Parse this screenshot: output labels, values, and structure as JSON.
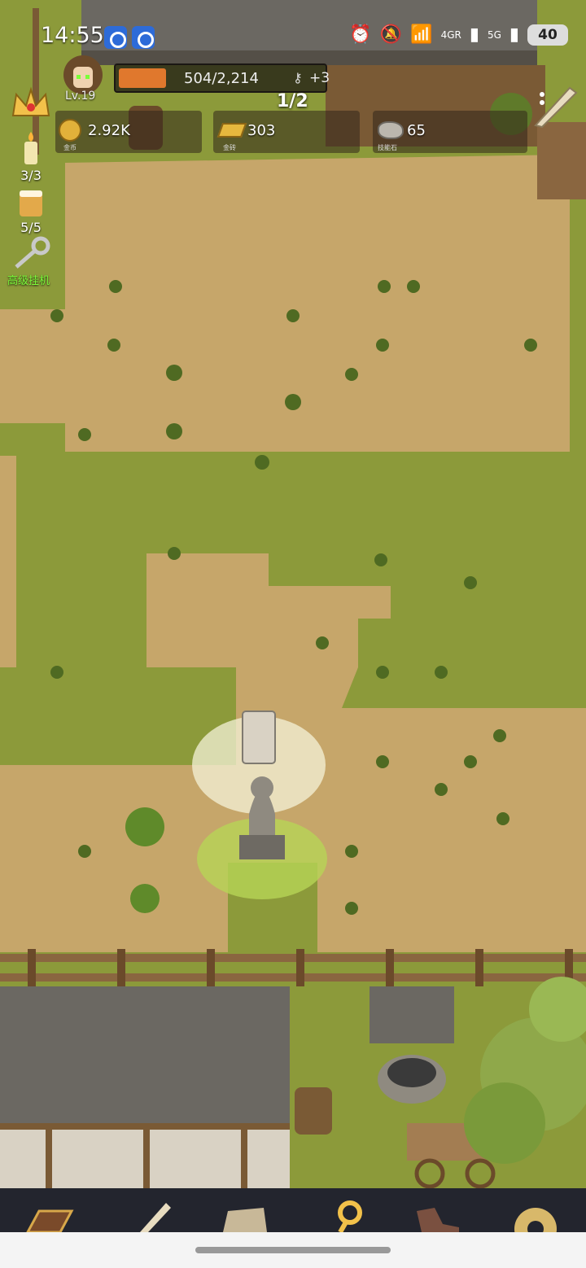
{
  "status_bar": {
    "time": "14:55",
    "signal_left": "4GR",
    "signal_right": "5G",
    "battery": "40"
  },
  "player": {
    "level": "Lv.19",
    "xp_text": "504/2,214",
    "xp_fraction": 0.23,
    "xp_bonus": "+3",
    "page_count": "1/2"
  },
  "resources": [
    {
      "icon": "gold-coin-icon",
      "value": "2.92K",
      "caption": "金币"
    },
    {
      "icon": "gold-brick-icon",
      "value": "303",
      "caption": "金砖"
    },
    {
      "icon": "skill-stone-icon",
      "value": "65",
      "caption": "技能石"
    }
  ],
  "side_buttons": {
    "candle_count": "3/3",
    "beer_count": "5/5",
    "afk_label": "高级挂机"
  },
  "bottom_nav": [
    {
      "icon": "book-icon"
    },
    {
      "icon": "quill-icon"
    },
    {
      "icon": "map-scroll-icon"
    },
    {
      "icon": "golden-key-icon"
    },
    {
      "icon": "boot-icon"
    },
    {
      "icon": "gear-icon"
    }
  ],
  "colors": {
    "xp_fill": "#e0782d",
    "afk_text": "#7cff3a",
    "nav_background": "#23252e"
  }
}
